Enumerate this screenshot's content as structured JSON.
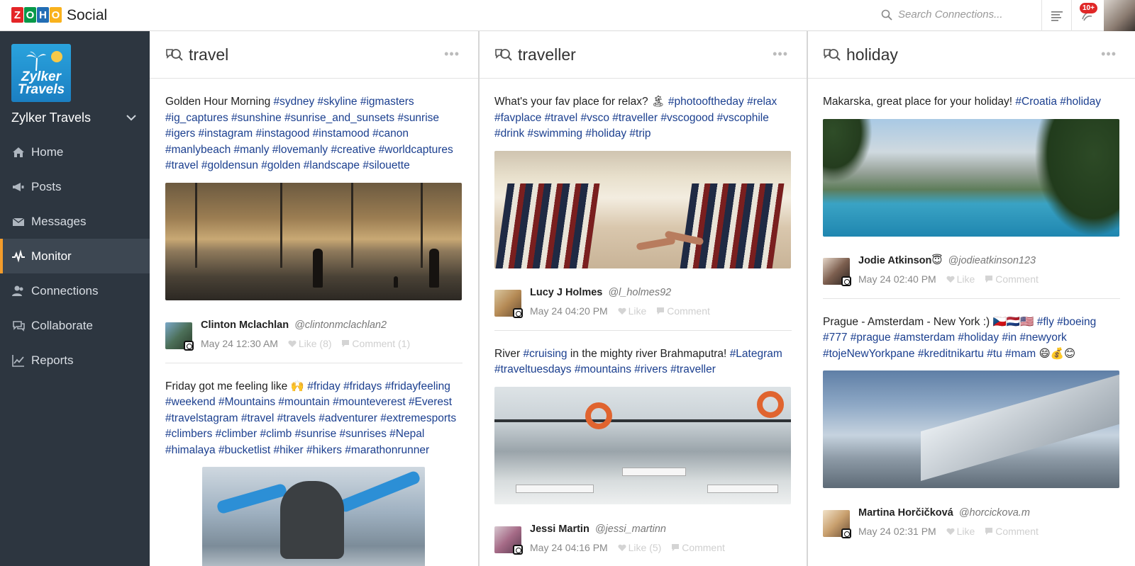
{
  "app": {
    "brand_letters": [
      "Z",
      "O",
      "H",
      "O"
    ],
    "name": "Social"
  },
  "search": {
    "placeholder": "Search Connections..."
  },
  "notifications": {
    "badge": "10+"
  },
  "sidebar": {
    "brand_logo_text": [
      "Zylker",
      "Travels"
    ],
    "brand_name": "Zylker Travels",
    "items": [
      {
        "label": "Home",
        "icon": "home-icon"
      },
      {
        "label": "Posts",
        "icon": "megaphone-icon"
      },
      {
        "label": "Messages",
        "icon": "envelope-icon"
      },
      {
        "label": "Monitor",
        "icon": "pulse-icon",
        "active": true
      },
      {
        "label": "Connections",
        "icon": "users-icon"
      },
      {
        "label": "Collaborate",
        "icon": "chat-icon"
      },
      {
        "label": "Reports",
        "icon": "chart-icon"
      }
    ]
  },
  "columns": [
    {
      "title": "travel",
      "menu": "•••",
      "posts": [
        {
          "text": "Golden Hour Morning",
          "tags": "#sydney #skyline #igmasters #ig_captures #sunshine #sunrise_and_sunsets #sunrise #igers #instagram #instagood #instamood #canon #manlybeach #manly #lovemanly #creative #worldcaptures #travel #goldensun #golden #landscape #silouette",
          "author": "Clinton Mclachlan",
          "handle": "@clintonmclachlan2",
          "time": "May 24 12:30 AM",
          "like": "Like (8)",
          "comment": "Comment (1)"
        },
        {
          "text": "Friday got me feeling like 🙌",
          "tags": "#friday #fridays #fridayfeeling #weekend #Mountains #mountain #mounteverest #Everest #travelstagram #travel #travels #adventurer #extremesports #climbers #climber #climb #sunrise #sunrises #Nepal #himalaya #bucketlist #hiker #hikers #marathonrunner"
        }
      ]
    },
    {
      "title": "traveller",
      "menu": "•••",
      "posts": [
        {
          "text": "What's your fav place for relax? 🏝",
          "tags": "#photooftheday #relax #favplace #travel #vsco #traveller #vscogood #vscophile #drink #swimming #holiday #trip",
          "author": "Lucy J Holmes",
          "handle": "@l_holmes92",
          "time": "May 24 04:20 PM",
          "like": "Like",
          "comment": "Comment"
        },
        {
          "text": "River",
          "tag_mid": "#cruising",
          "text2": "in the mighty river Brahmaputra!",
          "tags": "#Lategram #traveltuesdays #mountains #rivers #traveller",
          "author": "Jessi Martin",
          "handle": "@jessi_martinn",
          "time": "May 24 04:16 PM",
          "like": "Like (5)",
          "comment": "Comment"
        }
      ]
    },
    {
      "title": "holiday",
      "menu": "•••",
      "posts": [
        {
          "text": "Makarska, great place for your holiday!",
          "tags": "#Croatia #holiday",
          "author": "Jodie Atkinson😇",
          "handle": "@jodieatkinson123",
          "time": "May 24 02:40 PM",
          "like": "Like",
          "comment": "Comment"
        },
        {
          "text": "Prague - Amsterdam - New York :) 🇨🇿🇳🇱🇺🇸",
          "tags": "#fly #boeing #777 #prague #amsterdam #holiday #in #newyork #tojeNewYorkpane #kreditnikartu #tu #mam",
          "text_end": "😄💰😊",
          "author": "Martina Horčičková",
          "handle": "@horcickova.m",
          "time": "May 24 02:31 PM",
          "like": "Like",
          "comment": "Comment"
        }
      ]
    }
  ]
}
